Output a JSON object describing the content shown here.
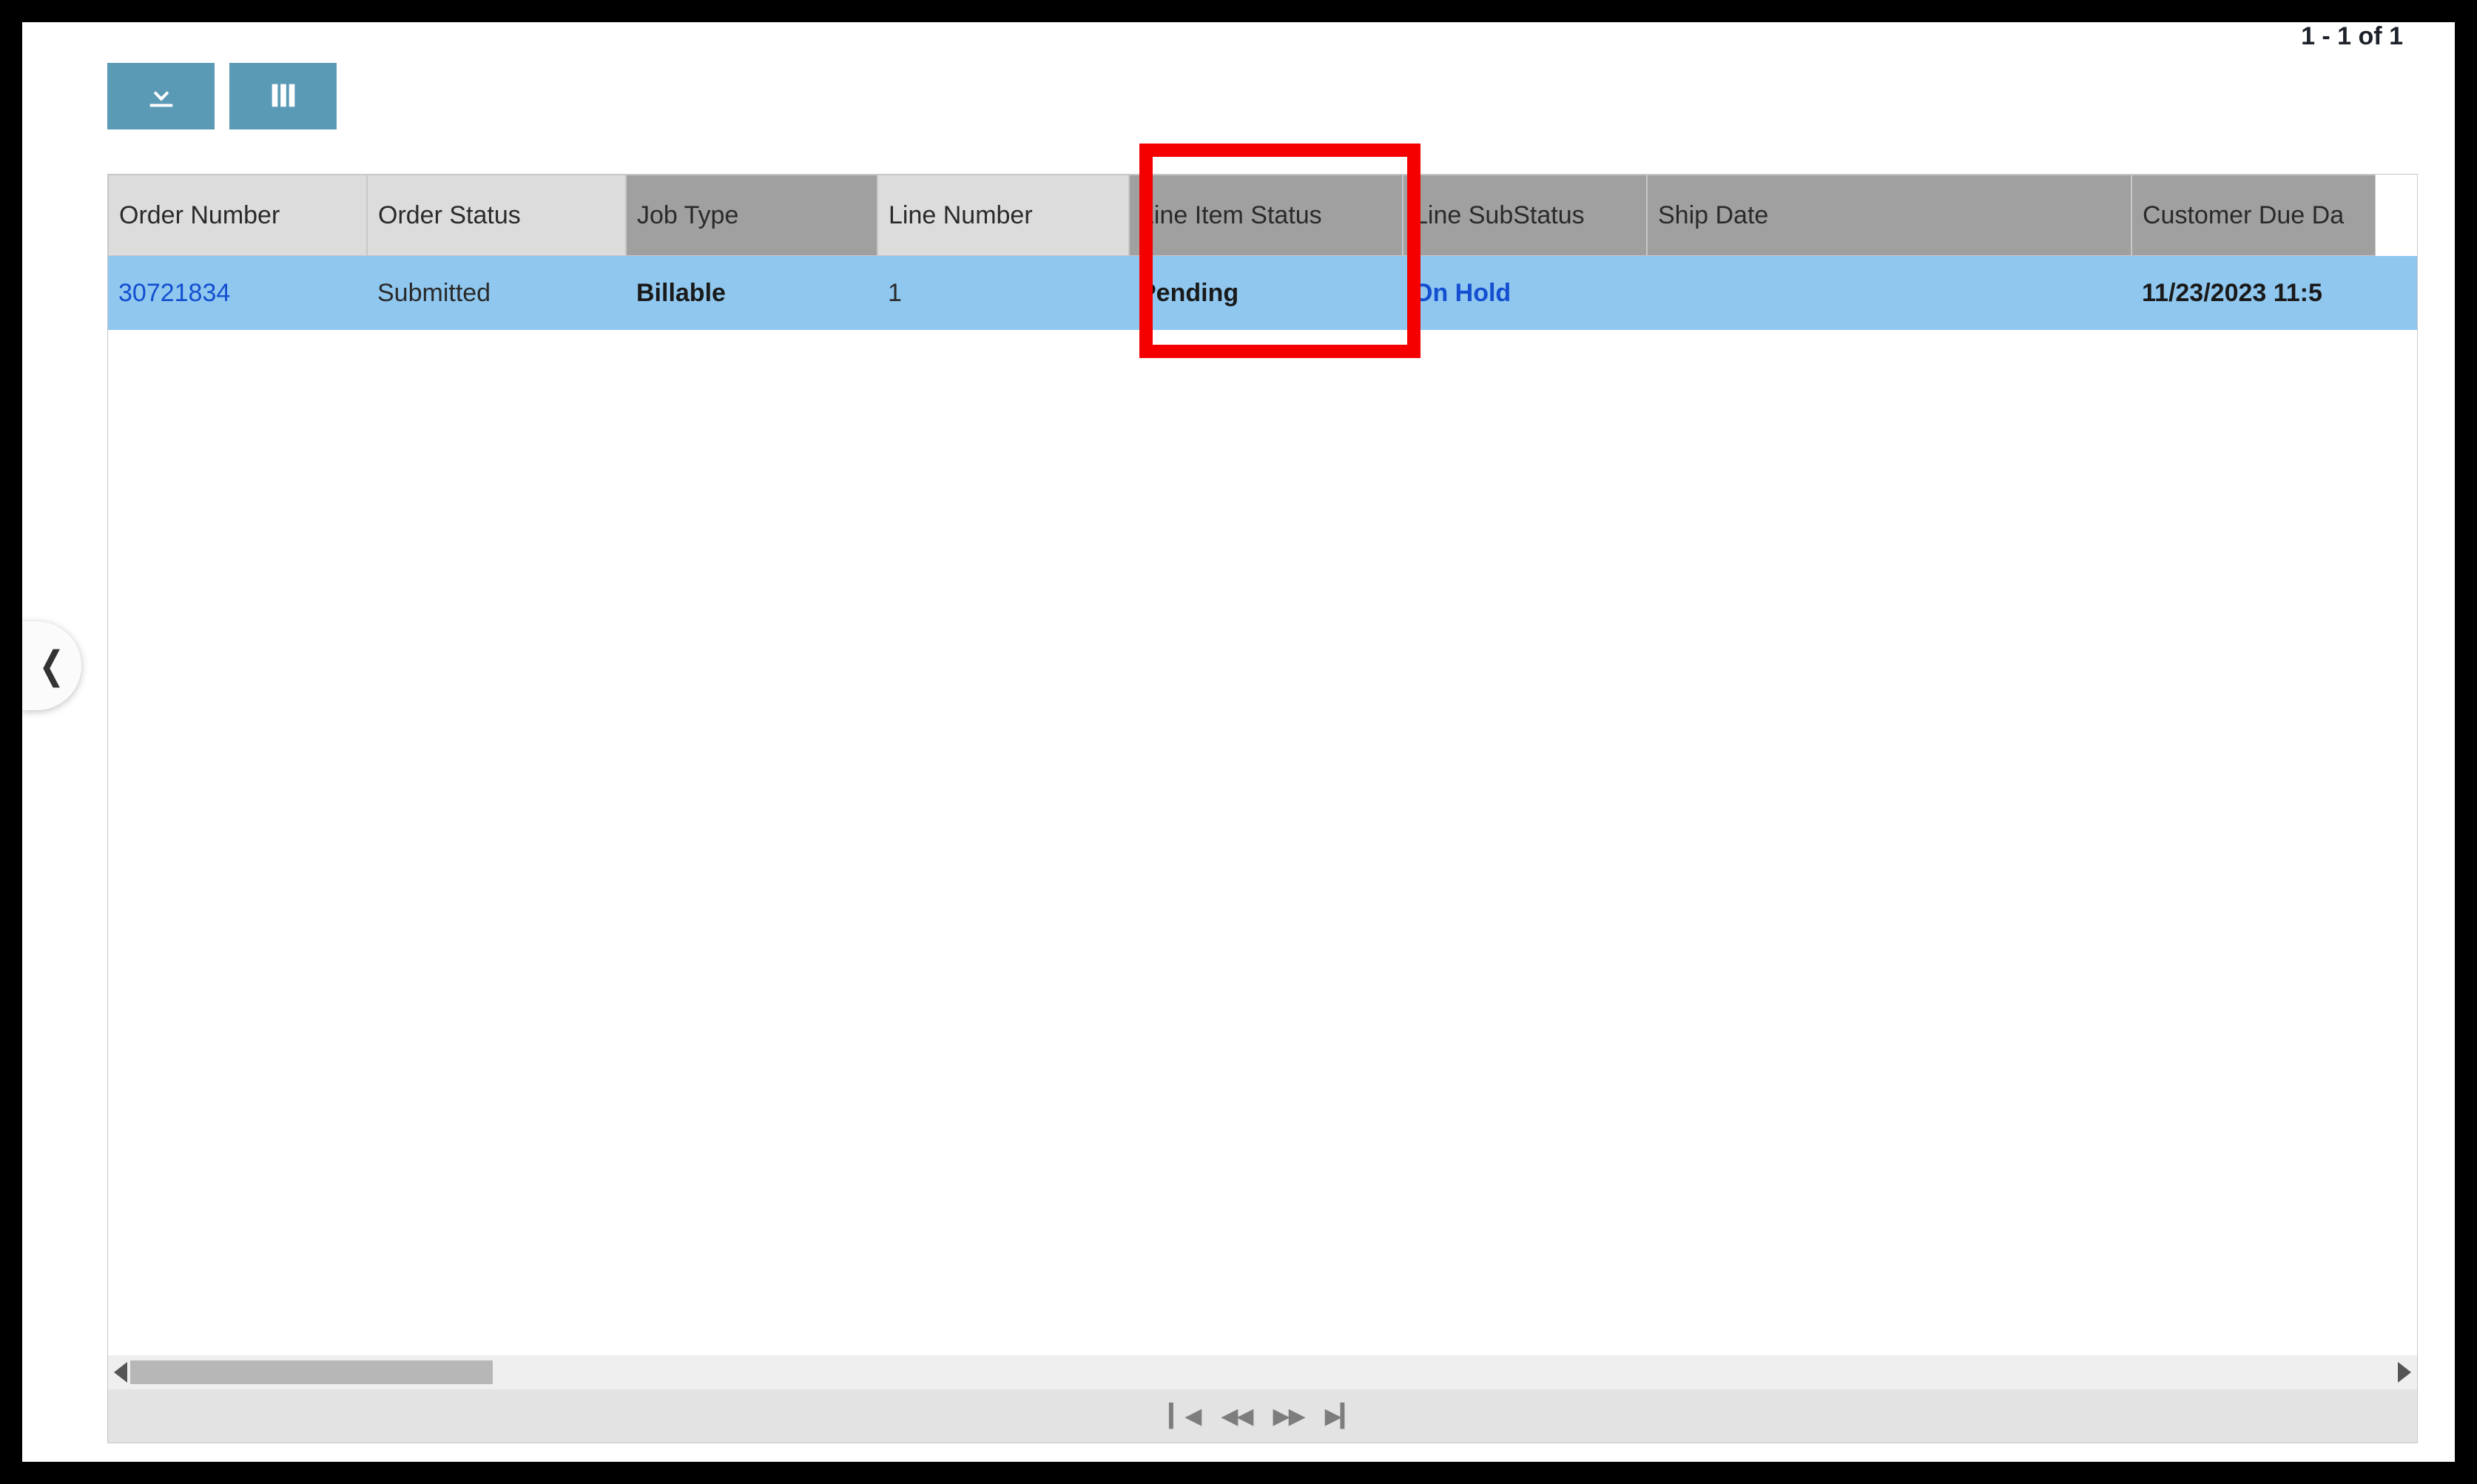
{
  "page_info": "1 - 1 of 1",
  "toolbar": {
    "download_label": "download",
    "columns_label": "columns"
  },
  "columns": [
    {
      "label": "Order Number",
      "shade": "light"
    },
    {
      "label": "Order Status",
      "shade": "light"
    },
    {
      "label": "Job Type",
      "shade": "dark"
    },
    {
      "label": "Line Number",
      "shade": "light"
    },
    {
      "label": "Line Item Status",
      "shade": "dark"
    },
    {
      "label": "Line SubStatus",
      "shade": "dark"
    },
    {
      "label": "Ship Date",
      "shade": "dark"
    },
    {
      "label": "Customer Due Da",
      "shade": "dark"
    }
  ],
  "rows": [
    {
      "order_number": "30721834",
      "order_status": "Submitted",
      "job_type": "Billable",
      "line_number": "1",
      "line_item_status": "Pending",
      "line_substatus": "On Hold",
      "ship_date": "",
      "customer_due": "11/23/2023 11:5"
    }
  ],
  "highlight_column": "Line Item Status",
  "pager": {
    "first": "⏮",
    "prev": "◀◀",
    "next": "▶▶",
    "last": "⏭"
  }
}
